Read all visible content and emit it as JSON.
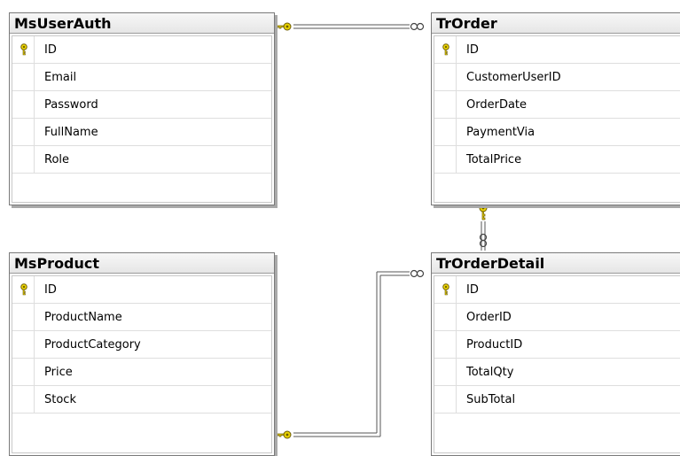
{
  "tables": [
    {
      "name": "MsUserAuth",
      "columns": [
        {
          "name": "ID",
          "primary_key": true
        },
        {
          "name": "Email",
          "primary_key": false
        },
        {
          "name": "Password",
          "primary_key": false
        },
        {
          "name": "FullName",
          "primary_key": false
        },
        {
          "name": "Role",
          "primary_key": false
        }
      ]
    },
    {
      "name": "TrOrder",
      "columns": [
        {
          "name": "ID",
          "primary_key": true
        },
        {
          "name": "CustomerUserID",
          "primary_key": false
        },
        {
          "name": "OrderDate",
          "primary_key": false
        },
        {
          "name": "PaymentVia",
          "primary_key": false
        },
        {
          "name": "TotalPrice",
          "primary_key": false
        }
      ]
    },
    {
      "name": "MsProduct",
      "columns": [
        {
          "name": "ID",
          "primary_key": true
        },
        {
          "name": "ProductName",
          "primary_key": false
        },
        {
          "name": "ProductCategory",
          "primary_key": false
        },
        {
          "name": "Price",
          "primary_key": false
        },
        {
          "name": "Stock",
          "primary_key": false
        }
      ]
    },
    {
      "name": "TrOrderDetail",
      "columns": [
        {
          "name": "ID",
          "primary_key": true
        },
        {
          "name": "OrderID",
          "primary_key": false
        },
        {
          "name": "ProductID",
          "primary_key": false
        },
        {
          "name": "TotalQty",
          "primary_key": false
        },
        {
          "name": "SubTotal",
          "primary_key": false
        }
      ]
    }
  ],
  "relationships": [
    {
      "from": "MsUserAuth",
      "to": "TrOrder",
      "from_end": "one-key-icon",
      "to_end": "many-infinity-icon"
    },
    {
      "from": "TrOrder",
      "to": "TrOrderDetail",
      "from_end": "one-key-icon",
      "to_end": "many-infinity-icon"
    },
    {
      "from": "MsProduct",
      "to": "TrOrderDetail",
      "from_end": "one-key-icon",
      "to_end": "many-infinity-icon"
    }
  ],
  "colors": {
    "key_icon": "#e8d200",
    "key_outline": "#6b5a00",
    "connector": "#555555"
  }
}
